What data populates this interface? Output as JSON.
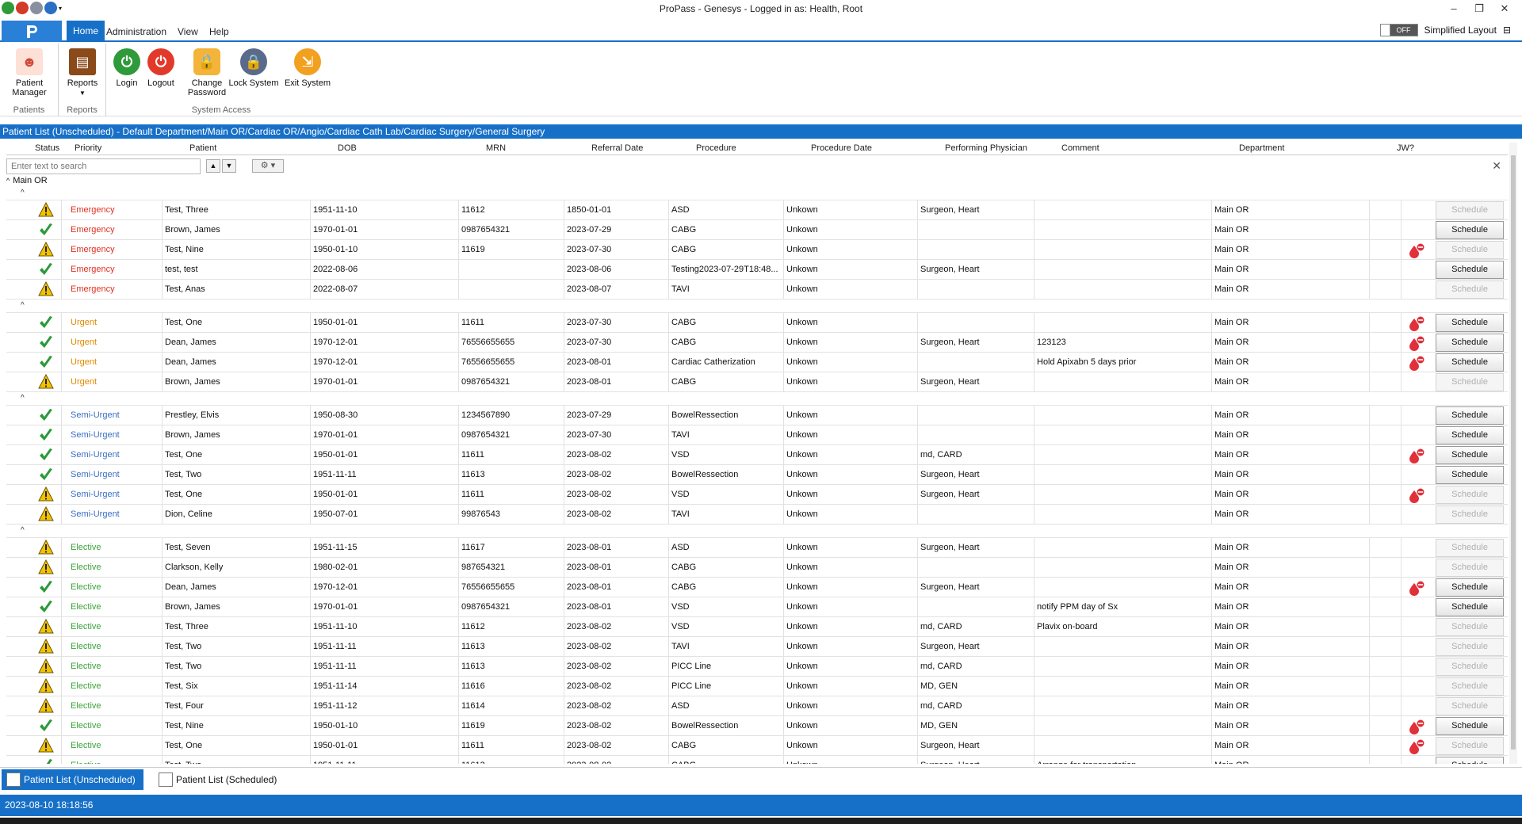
{
  "window": {
    "title": "ProPass - Genesys - Logged in as: Health, Root"
  },
  "window_controls": {
    "minimize": "–",
    "restore": "❐",
    "close": "✕"
  },
  "ribbon_tabs": [
    "Home",
    "Administration",
    "View",
    "Help"
  ],
  "simplified_layout": {
    "toggle": "OFF",
    "label": "Simplified Layout"
  },
  "ribbon": {
    "groups": {
      "patients": "Patients",
      "reports": "Reports",
      "system_access": "System Access"
    },
    "buttons": {
      "patient_manager": "Patient Manager",
      "reports": "Reports",
      "login": "Login",
      "logout": "Logout",
      "change_password": "Change Password",
      "lock_system": "Lock System",
      "exit_system": "Exit System"
    }
  },
  "list_title": "Patient List (Unscheduled) - Default Department/Main OR/Cardiac OR/Angio/Cardiac Cath Lab/Cardiac Surgery/General Surgery",
  "columns": {
    "status": "Status",
    "priority": "Priority",
    "patient": "Patient",
    "dob": "DOB",
    "mrn": "MRN",
    "referral_date": "Referral Date",
    "procedure": "Procedure",
    "procedure_date": "Procedure Date",
    "physician": "Performing Physician",
    "comment": "Comment",
    "department": "Department",
    "jw": "JW?"
  },
  "search": {
    "placeholder": "Enter text to search"
  },
  "group_header": "Main OR",
  "schedule_label": "Schedule",
  "colors": {
    "emergency": "#e03020",
    "urgent": "#e08a00",
    "semi_urgent": "#3a6fc4",
    "elective": "#3aa23a",
    "accent": "#1770c8"
  },
  "groups": [
    {
      "rows": [
        {
          "status": "warn",
          "priority": "Emergency",
          "patient": "Test, Three",
          "dob": "1951-11-10",
          "mrn": "11612",
          "referral": "1850-01-01",
          "procedure": "ASD",
          "proc_date": "Unkown",
          "physician": "Surgeon, Heart",
          "comment": "",
          "dept": "Main OR",
          "jw": false,
          "sched": false
        },
        {
          "status": "ok",
          "priority": "Emergency",
          "patient": "Brown, James",
          "dob": "1970-01-01",
          "mrn": "0987654321",
          "referral": "2023-07-29",
          "procedure": "CABG",
          "proc_date": "Unkown",
          "physician": "",
          "comment": "",
          "dept": "Main OR",
          "jw": false,
          "sched": true
        },
        {
          "status": "warn",
          "priority": "Emergency",
          "patient": "Test, Nine",
          "dob": "1950-01-10",
          "mrn": "11619",
          "referral": "2023-07-30",
          "procedure": "CABG",
          "proc_date": "Unkown",
          "physician": "",
          "comment": "",
          "dept": "Main OR",
          "jw": true,
          "sched": false
        },
        {
          "status": "ok",
          "priority": "Emergency",
          "patient": "test, test",
          "dob": "2022-08-06",
          "mrn": "",
          "referral": "2023-08-06",
          "procedure": "Testing2023-07-29T18:48...",
          "proc_date": "Unkown",
          "physician": "Surgeon, Heart",
          "comment": "",
          "dept": "Main OR",
          "jw": false,
          "sched": true
        },
        {
          "status": "warn",
          "priority": "Emergency",
          "patient": "Test, Anas",
          "dob": "2022-08-07",
          "mrn": "",
          "referral": "2023-08-07",
          "procedure": "TAVI",
          "proc_date": "Unkown",
          "physician": "",
          "comment": "",
          "dept": "Main OR",
          "jw": false,
          "sched": false
        }
      ]
    },
    {
      "rows": [
        {
          "status": "ok",
          "priority": "Urgent",
          "patient": "Test, One",
          "dob": "1950-01-01",
          "mrn": "11611",
          "referral": "2023-07-30",
          "procedure": "CABG",
          "proc_date": "Unkown",
          "physician": "",
          "comment": "",
          "dept": "Main OR",
          "jw": true,
          "sched": true
        },
        {
          "status": "ok",
          "priority": "Urgent",
          "patient": "Dean, James",
          "dob": "1970-12-01",
          "mrn": "76556655655",
          "referral": "2023-07-30",
          "procedure": "CABG",
          "proc_date": "Unkown",
          "physician": "Surgeon, Heart",
          "comment": "123123",
          "dept": "Main OR",
          "jw": true,
          "sched": true
        },
        {
          "status": "ok",
          "priority": "Urgent",
          "patient": "Dean, James",
          "dob": "1970-12-01",
          "mrn": "76556655655",
          "referral": "2023-08-01",
          "procedure": "Cardiac Catherization",
          "proc_date": "Unkown",
          "physician": "",
          "comment": "Hold Apixabn 5 days prior",
          "dept": "Main OR",
          "jw": true,
          "sched": true
        },
        {
          "status": "warn",
          "priority": "Urgent",
          "patient": "Brown, James",
          "dob": "1970-01-01",
          "mrn": "0987654321",
          "referral": "2023-08-01",
          "procedure": "CABG",
          "proc_date": "Unkown",
          "physician": "Surgeon, Heart",
          "comment": "",
          "dept": "Main OR",
          "jw": false,
          "sched": false
        }
      ]
    },
    {
      "rows": [
        {
          "status": "ok",
          "priority": "Semi-Urgent",
          "patient": "Prestley, Elvis",
          "dob": "1950-08-30",
          "mrn": "1234567890",
          "referral": "2023-07-29",
          "procedure": "BowelRessection",
          "proc_date": "Unkown",
          "physician": "",
          "comment": "",
          "dept": "Main OR",
          "jw": false,
          "sched": true
        },
        {
          "status": "ok",
          "priority": "Semi-Urgent",
          "patient": "Brown, James",
          "dob": "1970-01-01",
          "mrn": "0987654321",
          "referral": "2023-07-30",
          "procedure": "TAVI",
          "proc_date": "Unkown",
          "physician": "",
          "comment": "",
          "dept": "Main OR",
          "jw": false,
          "sched": true
        },
        {
          "status": "ok",
          "priority": "Semi-Urgent",
          "patient": "Test, One",
          "dob": "1950-01-01",
          "mrn": "11611",
          "referral": "2023-08-02",
          "procedure": "VSD",
          "proc_date": "Unkown",
          "physician": "md, CARD",
          "comment": "",
          "dept": "Main OR",
          "jw": true,
          "sched": true
        },
        {
          "status": "ok",
          "priority": "Semi-Urgent",
          "patient": "Test, Two",
          "dob": "1951-11-11",
          "mrn": "11613",
          "referral": "2023-08-02",
          "procedure": "BowelRessection",
          "proc_date": "Unkown",
          "physician": "Surgeon, Heart",
          "comment": "",
          "dept": "Main OR",
          "jw": false,
          "sched": true
        },
        {
          "status": "warn",
          "priority": "Semi-Urgent",
          "patient": "Test, One",
          "dob": "1950-01-01",
          "mrn": "11611",
          "referral": "2023-08-02",
          "procedure": "VSD",
          "proc_date": "Unkown",
          "physician": "Surgeon, Heart",
          "comment": "",
          "dept": "Main OR",
          "jw": true,
          "sched": false
        },
        {
          "status": "warn",
          "priority": "Semi-Urgent",
          "patient": "Dion, Celine",
          "dob": "1950-07-01",
          "mrn": "99876543",
          "referral": "2023-08-02",
          "procedure": "TAVI",
          "proc_date": "Unkown",
          "physician": "",
          "comment": "",
          "dept": "Main OR",
          "jw": false,
          "sched": false
        }
      ]
    },
    {
      "rows": [
        {
          "status": "warn",
          "priority": "Elective",
          "patient": "Test, Seven",
          "dob": "1951-11-15",
          "mrn": "11617",
          "referral": "2023-08-01",
          "procedure": "ASD",
          "proc_date": "Unkown",
          "physician": "Surgeon, Heart",
          "comment": "",
          "dept": "Main OR",
          "jw": false,
          "sched": false
        },
        {
          "status": "warn",
          "priority": "Elective",
          "patient": "Clarkson, Kelly",
          "dob": "1980-02-01",
          "mrn": "987654321",
          "referral": "2023-08-01",
          "procedure": "CABG",
          "proc_date": "Unkown",
          "physician": "",
          "comment": "",
          "dept": "Main OR",
          "jw": false,
          "sched": false
        },
        {
          "status": "ok",
          "priority": "Elective",
          "patient": "Dean, James",
          "dob": "1970-12-01",
          "mrn": "76556655655",
          "referral": "2023-08-01",
          "procedure": "CABG",
          "proc_date": "Unkown",
          "physician": "Surgeon, Heart",
          "comment": "",
          "dept": "Main OR",
          "jw": true,
          "sched": true
        },
        {
          "status": "ok",
          "priority": "Elective",
          "patient": "Brown, James",
          "dob": "1970-01-01",
          "mrn": "0987654321",
          "referral": "2023-08-01",
          "procedure": "VSD",
          "proc_date": "Unkown",
          "physician": "",
          "comment": "notify PPM day of Sx",
          "dept": "Main OR",
          "jw": false,
          "sched": true
        },
        {
          "status": "warn",
          "priority": "Elective",
          "patient": "Test, Three",
          "dob": "1951-11-10",
          "mrn": "11612",
          "referral": "2023-08-02",
          "procedure": "VSD",
          "proc_date": "Unkown",
          "physician": "md, CARD",
          "comment": "Plavix on-board",
          "dept": "Main OR",
          "jw": false,
          "sched": false
        },
        {
          "status": "warn",
          "priority": "Elective",
          "patient": "Test, Two",
          "dob": "1951-11-11",
          "mrn": "11613",
          "referral": "2023-08-02",
          "procedure": "TAVI",
          "proc_date": "Unkown",
          "physician": "Surgeon, Heart",
          "comment": "",
          "dept": "Main OR",
          "jw": false,
          "sched": false
        },
        {
          "status": "warn",
          "priority": "Elective",
          "patient": "Test, Two",
          "dob": "1951-11-11",
          "mrn": "11613",
          "referral": "2023-08-02",
          "procedure": "PICC Line",
          "proc_date": "Unkown",
          "physician": "md, CARD",
          "comment": "",
          "dept": "Main OR",
          "jw": false,
          "sched": false
        },
        {
          "status": "warn",
          "priority": "Elective",
          "patient": "Test, Six",
          "dob": "1951-11-14",
          "mrn": "11616",
          "referral": "2023-08-02",
          "procedure": "PICC Line",
          "proc_date": "Unkown",
          "physician": "MD, GEN",
          "comment": "",
          "dept": "Main OR",
          "jw": false,
          "sched": false
        },
        {
          "status": "warn",
          "priority": "Elective",
          "patient": "Test, Four",
          "dob": "1951-11-12",
          "mrn": "11614",
          "referral": "2023-08-02",
          "procedure": "ASD",
          "proc_date": "Unkown",
          "physician": "md, CARD",
          "comment": "",
          "dept": "Main OR",
          "jw": false,
          "sched": false
        },
        {
          "status": "ok",
          "priority": "Elective",
          "patient": "Test, Nine",
          "dob": "1950-01-10",
          "mrn": "11619",
          "referral": "2023-08-02",
          "procedure": "BowelRessection",
          "proc_date": "Unkown",
          "physician": "MD, GEN",
          "comment": "",
          "dept": "Main OR",
          "jw": true,
          "sched": true
        },
        {
          "status": "warn",
          "priority": "Elective",
          "patient": "Test, One",
          "dob": "1950-01-01",
          "mrn": "11611",
          "referral": "2023-08-02",
          "procedure": "CABG",
          "proc_date": "Unkown",
          "physician": "Surgeon, Heart",
          "comment": "",
          "dept": "Main OR",
          "jw": true,
          "sched": false
        },
        {
          "status": "ok",
          "priority": "Elective",
          "patient": "Test, Two",
          "dob": "1951-11-11",
          "mrn": "11613",
          "referral": "2023-08-02",
          "procedure": "CABG",
          "proc_date": "Unkown",
          "physician": "Surgeon, Heart",
          "comment": "Arrange for transportation",
          "dept": "Main OR",
          "jw": false,
          "sched": true
        }
      ]
    }
  ],
  "bottom_tabs": [
    "Patient List (Unscheduled)",
    "Patient List (Scheduled)"
  ],
  "status_bar": {
    "datetime": "2023-08-10 18:18:56"
  }
}
